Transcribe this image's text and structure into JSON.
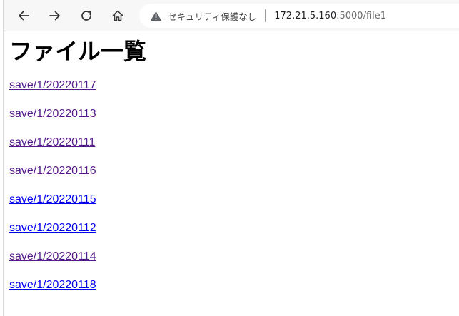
{
  "browser": {
    "security_label": "セキュリティ保護なし",
    "url_host": "172.21.5.160",
    "url_rest": ":5000/file1"
  },
  "page": {
    "title": "ファイル一覧",
    "files": [
      {
        "label": "save/1/20220117",
        "visited": true
      },
      {
        "label": "save/1/20220113",
        "visited": true
      },
      {
        "label": "save/1/20220111",
        "visited": true
      },
      {
        "label": "save/1/20220116",
        "visited": true
      },
      {
        "label": "save/1/20220115",
        "visited": false
      },
      {
        "label": "save/1/20220112",
        "visited": false
      },
      {
        "label": "save/1/20220114",
        "visited": true
      },
      {
        "label": "save/1/20220118",
        "visited": false
      }
    ]
  },
  "colors": {
    "visited_link": "#551a8b",
    "unvisited_link": "#0000ee",
    "toolbar_bg": "#f7f7f7"
  },
  "icons": [
    "back-icon",
    "forward-icon",
    "reload-icon",
    "home-icon",
    "warning-icon"
  ]
}
